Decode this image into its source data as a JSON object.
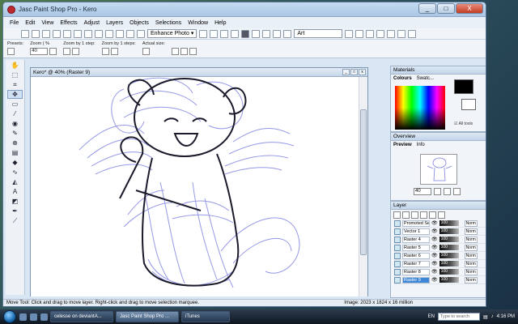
{
  "window": {
    "title": "Jasc Paint Shop Pro - Kero",
    "controls": [
      "_",
      "□",
      "X"
    ]
  },
  "menu": [
    {
      "key": "F",
      "label": "File"
    },
    {
      "key": "E",
      "label": "Edit"
    },
    {
      "key": "V",
      "label": "View"
    },
    {
      "key": "E",
      "label": "Effects"
    },
    {
      "key": "A",
      "label": "Adjust"
    },
    {
      "key": "L",
      "label": "Layers"
    },
    {
      "key": "O",
      "label": "Objects"
    },
    {
      "key": "S",
      "label": "Selections"
    },
    {
      "key": "W",
      "label": "Window"
    },
    {
      "key": "H",
      "label": "Help"
    }
  ],
  "toolbar": {
    "enhance_label": "Enhance Photo ▾",
    "script_value": "Art"
  },
  "options": {
    "presets_label": "Presets:",
    "zoom_label": "Zoom ( %",
    "zoom_value": "40",
    "zoom_step1_label": "Zoom by 1 step:",
    "zoom_step2_label": "Zoom by 1 steps:",
    "actual_size_label": "Actual size:"
  },
  "document": {
    "title": "Kero* @ 40% (Raster 9)"
  },
  "materials": {
    "title": "Materials",
    "tabs": [
      "Colours",
      "Swatc..."
    ],
    "all_tools_label": "All tools"
  },
  "overview": {
    "title": "Overview",
    "tabs": [
      "Preview",
      "Info"
    ],
    "zoom_value": "40"
  },
  "layers": {
    "title": "Layer",
    "rows": [
      {
        "name": "Promoted Sele",
        "opacity": "100",
        "blend": "Norm"
      },
      {
        "name": "Vector 1",
        "opacity": "100",
        "blend": "Norm"
      },
      {
        "name": "Raster 4",
        "opacity": "100",
        "blend": "Norm"
      },
      {
        "name": "Raster 5",
        "opacity": "100",
        "blend": "Norm"
      },
      {
        "name": "Raster 6",
        "opacity": "100",
        "blend": "Norm"
      },
      {
        "name": "Raster 7",
        "opacity": "100",
        "blend": "Norm"
      },
      {
        "name": "Raster 8",
        "opacity": "100",
        "blend": "Norm"
      },
      {
        "name": "Raster 9",
        "opacity": "100",
        "blend": "Norm",
        "selected": true
      }
    ]
  },
  "status": {
    "hint": "Move Tool: Click and drag to move layer. Right-click and drag to move selection marquee.",
    "image_info": "Image: 2023 x 1824 x 16 million"
  },
  "taskbar": {
    "tasks": [
      "celesse on deviantA...",
      "Jasc Paint Shop Pro ...",
      "iTunes"
    ],
    "active_task_index": 1,
    "lang": "EN",
    "search_placeholder": "Type to search",
    "clock": "4:16 PM"
  },
  "colors": {
    "accent": "#3d87d6",
    "sketch": "#7b7fe0"
  }
}
